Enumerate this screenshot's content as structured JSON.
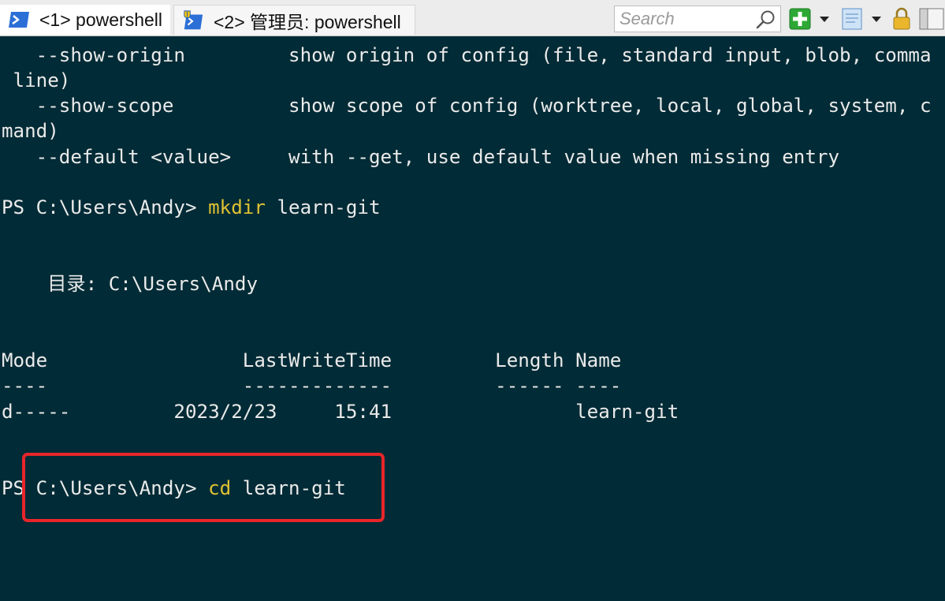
{
  "tabs": [
    {
      "label": "<1> powershell",
      "icon": "powershell-icon"
    },
    {
      "label": "<2> 管理员: powershell",
      "icon": "admin-shield-icon"
    }
  ],
  "search": {
    "placeholder": "Search"
  },
  "toolbar": {
    "icons": [
      "add-console-icon",
      "dropdown-arrow-icon",
      "document-icon",
      "dropdown-arrow-icon",
      "lock-icon",
      "panel-icon"
    ]
  },
  "console": {
    "lines": [
      "   --show-origin         show origin of config (file, standard input, blob, comma",
      " line)",
      "   --show-scope          show scope of config (worktree, local, global, system, c",
      "mand)",
      "   --default <value>     with --get, use default value when missing entry",
      "",
      "",
      "",
      "",
      "    目录: C:\\Users\\Andy",
      "",
      "",
      "Mode                 LastWriteTime         Length Name",
      "----                 -------------         ------ ----",
      "d-----         2023/2/23     15:41                learn-git",
      "",
      "",
      ""
    ],
    "prompts": [
      {
        "prompt": "PS C:\\Users\\Andy> ",
        "command": "mkdir",
        "args": " learn-git"
      },
      {
        "prompt": "PS C:\\Users\\Andy> ",
        "command": "cd",
        "args": " learn-git"
      }
    ]
  },
  "colors": {
    "console_background": "#012b36",
    "console_text": "#eaeaea",
    "command_text": "#e0c232",
    "highlight_border": "#e8252a"
  }
}
